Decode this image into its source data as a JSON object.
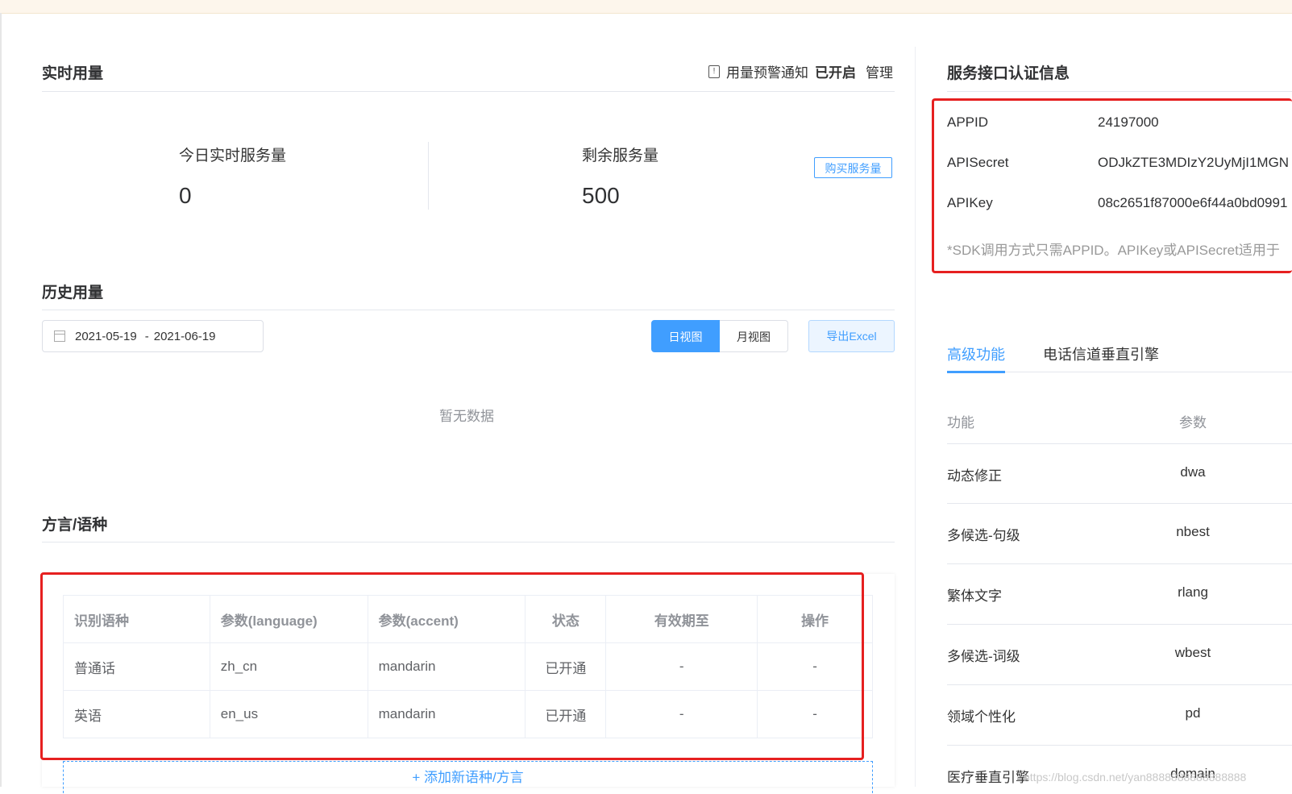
{
  "realtime": {
    "title": "实时用量",
    "alert_label": "用量预警通知",
    "alert_status": "已开启",
    "alert_manage": "管理",
    "today_label": "今日实时服务量",
    "today_value": "0",
    "remaining_label": "剩余服务量",
    "remaining_value": "500",
    "buy_button": "购买服务量"
  },
  "history": {
    "title": "历史用量",
    "date_start": "2021-05-19",
    "date_sep": "-",
    "date_end": "2021-06-19",
    "day_view": "日视图",
    "month_view": "月视图",
    "export": "导出Excel",
    "empty": "暂无数据"
  },
  "dialect": {
    "title": "方言/语种",
    "columns": [
      "识别语种",
      "参数(language)",
      "参数(accent)",
      "状态",
      "有效期至",
      "操作"
    ],
    "rows": [
      [
        "普通话",
        "zh_cn",
        "mandarin",
        "已开通",
        "-",
        "-"
      ],
      [
        "英语",
        "en_us",
        "mandarin",
        "已开通",
        "-",
        "-"
      ]
    ],
    "add_button": "+ 添加新语种/方言"
  },
  "credentials": {
    "title": "服务接口认证信息",
    "items": [
      {
        "label": "APPID",
        "value": "24197000"
      },
      {
        "label": "APISecret",
        "value": "ODJkZTE3MDIzY2UyMjI1MGN"
      },
      {
        "label": "APIKey",
        "value": "08c2651f87000e6f44a0bd0991"
      }
    ],
    "note": "*SDK调用方式只需APPID。APIKey或APISecret适用于"
  },
  "tabs": [
    "高级功能",
    "电话信道垂直引擎"
  ],
  "features": {
    "header": [
      "功能",
      "参数"
    ],
    "rows": [
      {
        "name": "动态修正",
        "param": "dwa"
      },
      {
        "name": "多候选-句级",
        "param": "nbest"
      },
      {
        "name": "繁体文字",
        "param": "rlang"
      },
      {
        "name": "多候选-词级",
        "param": "wbest"
      },
      {
        "name": "领域个性化",
        "param": "pd"
      },
      {
        "name": "医疗垂直引擎",
        "param": "domain"
      }
    ]
  },
  "watermark": "https://blog.csdn.net/yan8888888888888888"
}
